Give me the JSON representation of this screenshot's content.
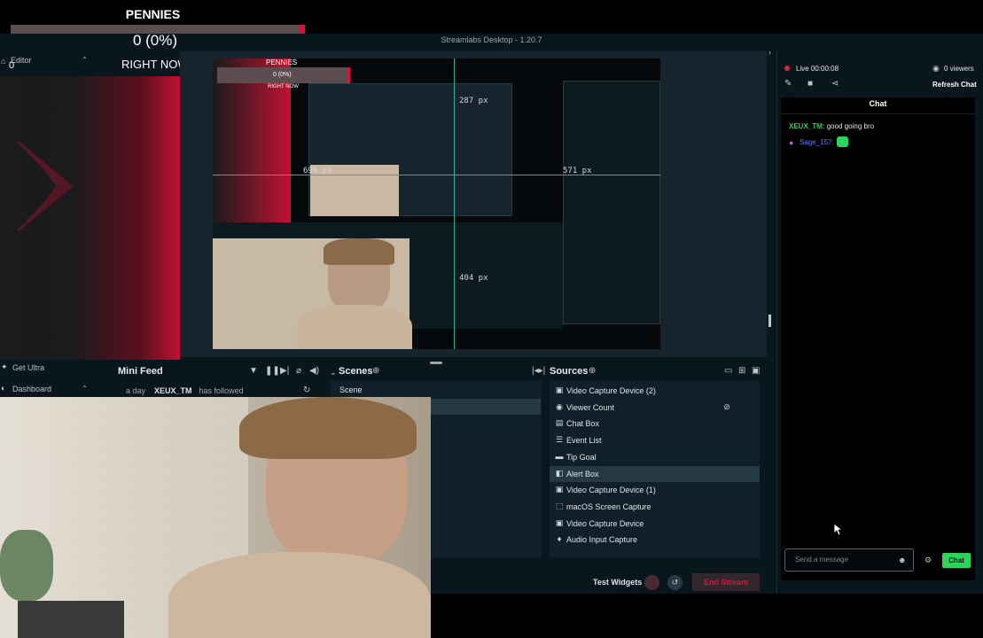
{
  "window": {
    "title": "Streamlabs Desktop - 1.20.7"
  },
  "overlay": {
    "goal_title": "PENNIES",
    "goal_value": "0 (0%)",
    "goal_subtitle": "RIGHT NOW",
    "goal_fill": 0,
    "small_count": "0"
  },
  "sidebar": {
    "editor": "Editor",
    "get_ultra": "Get Ultra",
    "dashboard": "Dashboard"
  },
  "preview": {
    "guides": {
      "top": "287 px",
      "left": "696 px",
      "right": "571 px",
      "bottom": "404 px"
    },
    "nested_goal_title": "PENNIES",
    "nested_goal_value": "0 (0%)",
    "nested_goal_subtitle": "RIGHT NOW"
  },
  "mini_feed": {
    "title": "Mini Feed",
    "events": [
      {
        "time": "a day",
        "user": "XEUX_TM",
        "action": "has followed"
      }
    ]
  },
  "scenes": {
    "title": "Scenes",
    "items": [
      "Scene"
    ]
  },
  "sources": {
    "title": "Sources",
    "selected_index": 5,
    "items": [
      {
        "label": "Video Capture Device (2)",
        "icon": "camera-icon"
      },
      {
        "label": "Viewer Count",
        "icon": "eye-icon"
      },
      {
        "label": "Chat Box",
        "icon": "chat-icon"
      },
      {
        "label": "Event List",
        "icon": "list-icon"
      },
      {
        "label": "Tip Goal",
        "icon": "goal-icon"
      },
      {
        "label": "Alert Box",
        "icon": "alert-icon"
      },
      {
        "label": "Video Capture Device (1)",
        "icon": "camera-icon"
      },
      {
        "label": "macOS Screen Capture",
        "icon": "screen-capture-icon"
      },
      {
        "label": "Video Capture Device",
        "icon": "camera-icon"
      },
      {
        "label": "Audio Input Capture",
        "icon": "microphone-icon"
      }
    ]
  },
  "footer": {
    "test_widgets": "Test Widgets",
    "end_stream": "End Stream"
  },
  "chat_panel": {
    "live": "Live 00:00:08",
    "viewers": "0 viewers",
    "refresh": "Refresh Chat",
    "title": "Chat",
    "messages": [
      {
        "user": "XEUX_TM:",
        "text": "good going bro",
        "user_color": "#31c75a"
      },
      {
        "user": "Sage_157:",
        "text": "",
        "user_color": "#5b7cff"
      }
    ],
    "input_placeholder": "Send a message",
    "send_button": "Chat"
  },
  "colors": {
    "app_bg": "#09161d",
    "accent_red": "#d8123a",
    "accent_green": "#2bd45a",
    "panel_bg": "#10202a"
  }
}
